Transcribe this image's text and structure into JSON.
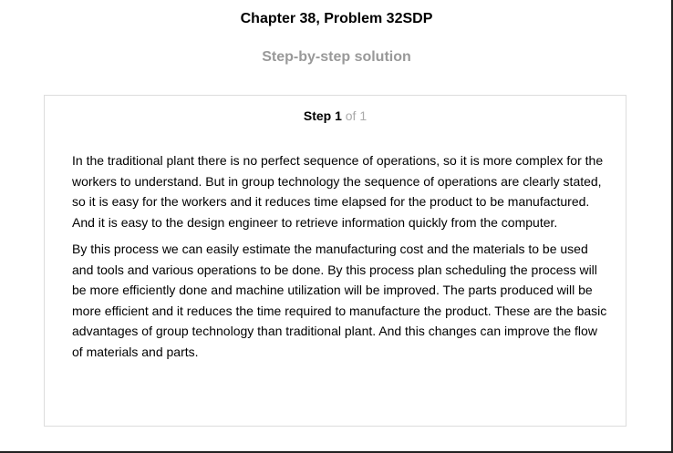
{
  "header": {
    "chapter_title": "Chapter 38, Problem 32SDP",
    "solution_heading": "Step-by-step solution"
  },
  "step": {
    "label": "Step 1",
    "of_text": " of 1",
    "paragraphs": [
      "In the traditional plant there is no perfect sequence of operations, so it is more complex for the workers to understand. But in group technology the sequence of operations are clearly stated, so it is easy for the workers and it reduces time elapsed for the product to be manufactured. And it is easy to the design engineer to retrieve information quickly from the computer.",
      "By this process we can easily estimate the manufacturing cost and the materials to be used and tools and various operations to be done. By this process plan scheduling the process will be more efficiently done and machine utilization will be improved. The parts produced will be more efficient and it reduces the time required to manufacture the product. These are the basic advantages of group technology than traditional plant. And this changes can improve the flow of materials and parts."
    ]
  }
}
